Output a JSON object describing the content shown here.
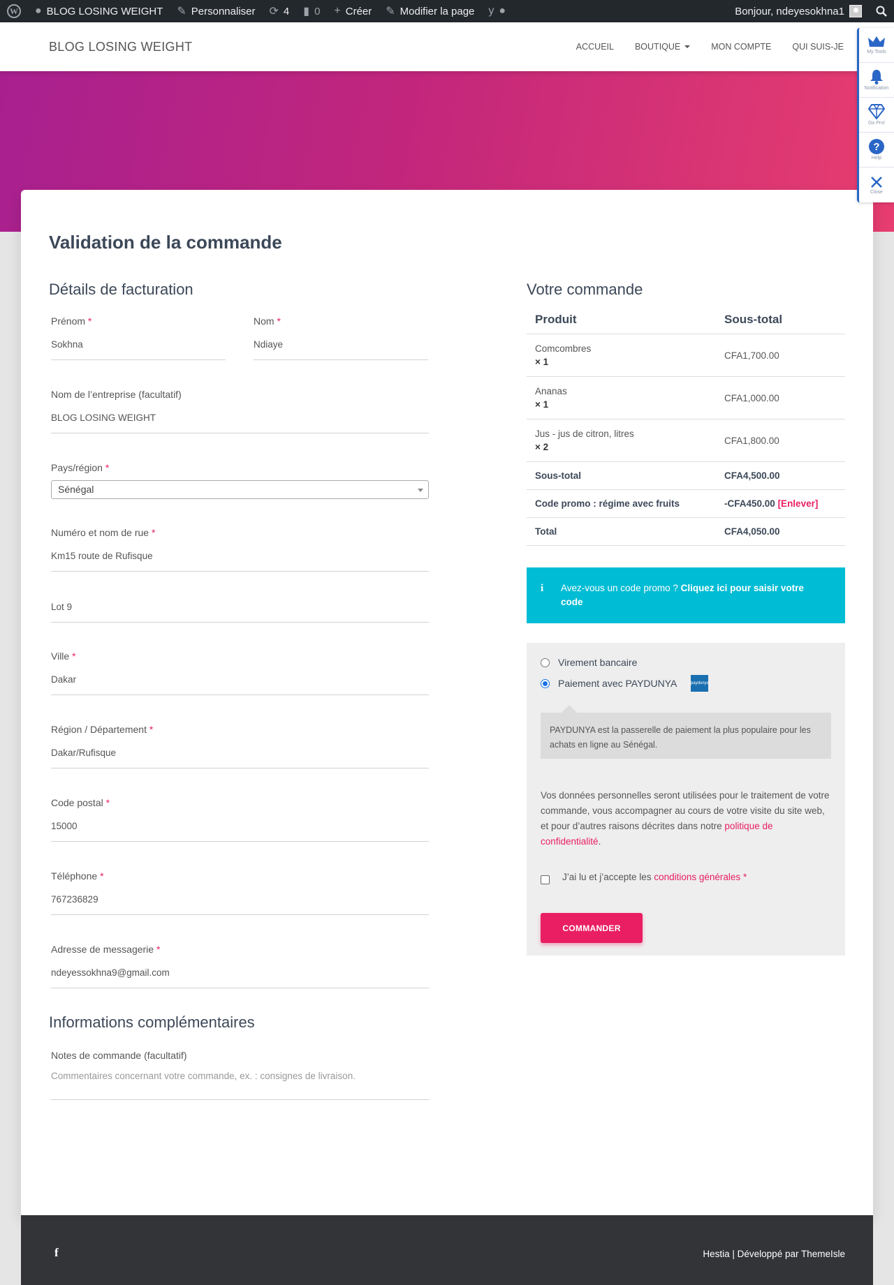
{
  "adminbar": {
    "site_name": "BLOG LOSING WEIGHT",
    "customize": "Personnaliser",
    "updates_count": "4",
    "comments_count": "0",
    "new": "Créer",
    "edit_page": "Modifier la page",
    "greeting": "Bonjour, ndeyesokhna1"
  },
  "header": {
    "brand": "BLOG LOSING WEIGHT",
    "nav": [
      "ACCUEIL",
      "BOUTIQUE",
      "MON COMPTE",
      "QUI SUIS-JE"
    ]
  },
  "tools": [
    "My Tools",
    "Notification",
    "Go Pro!",
    "Help",
    "Close"
  ],
  "page": {
    "title": "Validation de la commande",
    "billing_heading": "Détails de facturation",
    "order_heading": "Votre commande",
    "extra_heading": "Informations complémentaires"
  },
  "billing": {
    "first_name": {
      "label": "Prénom",
      "value": "Sokhna"
    },
    "last_name": {
      "label": "Nom",
      "value": "Ndiaye"
    },
    "company": {
      "label": "Nom de l’entreprise (facultatif)",
      "value": "BLOG LOSING WEIGHT"
    },
    "country": {
      "label": "Pays/région",
      "value": "Sénégal"
    },
    "street": {
      "label": "Numéro et nom de rue",
      "value": "Km15 route de Rufisque"
    },
    "street2": {
      "value": "Lot 9"
    },
    "city": {
      "label": "Ville",
      "value": "Dakar"
    },
    "state": {
      "label": "Région / Département",
      "value": "Dakar/Rufisque"
    },
    "postcode": {
      "label": "Code postal",
      "value": "15000"
    },
    "phone": {
      "label": "Téléphone",
      "value": "767236829"
    },
    "email": {
      "label": "Adresse de messagerie",
      "value": "ndeyessokhna9@gmail.com"
    },
    "required_mark": "*"
  },
  "notes": {
    "label": "Notes de commande (facultatif)",
    "placeholder": "Commentaires concernant votre commande, ex. : consignes de livraison."
  },
  "order": {
    "col_product": "Produit",
    "col_subtotal": "Sous-total",
    "items": [
      {
        "name": "Comcombres",
        "qty": "× 1",
        "total": "CFA1,700.00"
      },
      {
        "name": "Ananas",
        "qty": "× 1",
        "total": "CFA1,000.00"
      },
      {
        "name": "Jus - jus de citron, litres",
        "qty": "× 2",
        "total": "CFA1,800.00"
      }
    ],
    "subtotal_label": "Sous-total",
    "subtotal": "CFA4,500.00",
    "coupon_label": "Code promo : régime avec fruits",
    "coupon_value": "-CFA450.00",
    "coupon_remove": "[Enlever]",
    "total_label": "Total",
    "total": "CFA4,050.00"
  },
  "promo": {
    "text": "Avez-vous un code promo ?",
    "link": "Cliquez ici pour saisir votre code"
  },
  "payment": {
    "method1": "Virement bancaire",
    "method2": "Paiement avec PAYDUNYA",
    "logo_text": "paydunya",
    "description": "PAYDUNYA est la passerelle de paiement la plus populaire pour les achats en ligne au Sénégal.",
    "privacy_text": "Vos données personnelles seront utilisées pour le traitement de votre commande, vous accompagner au cours de votre visite du site web, et pour d’autres raisons décrites dans notre",
    "privacy_link": "politique de confidentialité",
    "privacy_end": ".",
    "terms_text": "J’ai lu et j’accepte les",
    "terms_link": "conditions générales",
    "terms_req": "*",
    "button": "COMMANDER"
  },
  "footer": {
    "fb": "f",
    "credit_theme": "Hestia",
    "credit_sep": " | Développé par ",
    "credit_author": "ThemeIsle"
  },
  "colors": {
    "accent": "#e91e63",
    "info": "#00bcd4",
    "footer": "#323437",
    "adminbar": "#23282d"
  }
}
